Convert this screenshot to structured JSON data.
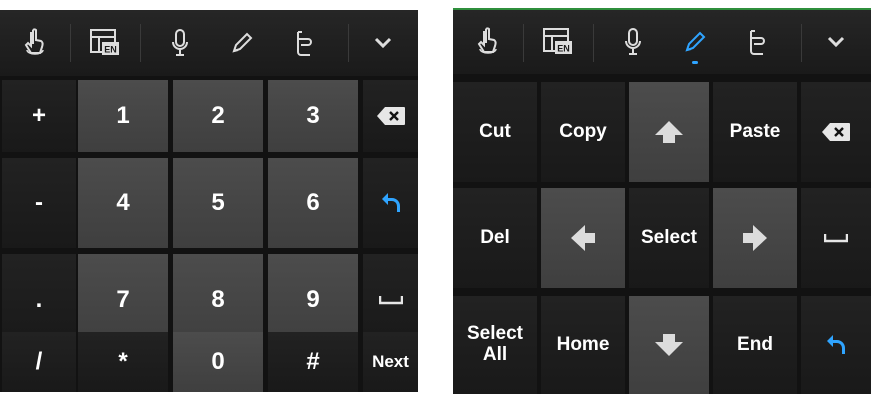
{
  "toolbar": {
    "icons": [
      "gesture-icon",
      "layout-en-icon",
      "microphone-icon",
      "pencil-icon",
      "text-cursor-icon",
      "chevron-down-icon"
    ],
    "layout_badge": "EN"
  },
  "numpad": {
    "rows": [
      [
        "+",
        "1",
        "2",
        "3",
        "backspace"
      ],
      [
        "-",
        "4",
        "5",
        "6",
        "enter"
      ],
      [
        ".",
        "7",
        "8",
        "9",
        "space"
      ],
      [
        "/",
        "*",
        "0",
        "#",
        "Next"
      ]
    ]
  },
  "editpad": {
    "cut": "Cut",
    "copy": "Copy",
    "paste": "Paste",
    "del": "Del",
    "select": "Select",
    "select_all_line1": "Select",
    "select_all_line2": "All",
    "home": "Home",
    "end": "End"
  },
  "colors": {
    "accent": "#2fa4ff",
    "active_top_border": "#2f8f3c",
    "key_dark": "#1d1d1d",
    "key_mid": "#474747"
  }
}
